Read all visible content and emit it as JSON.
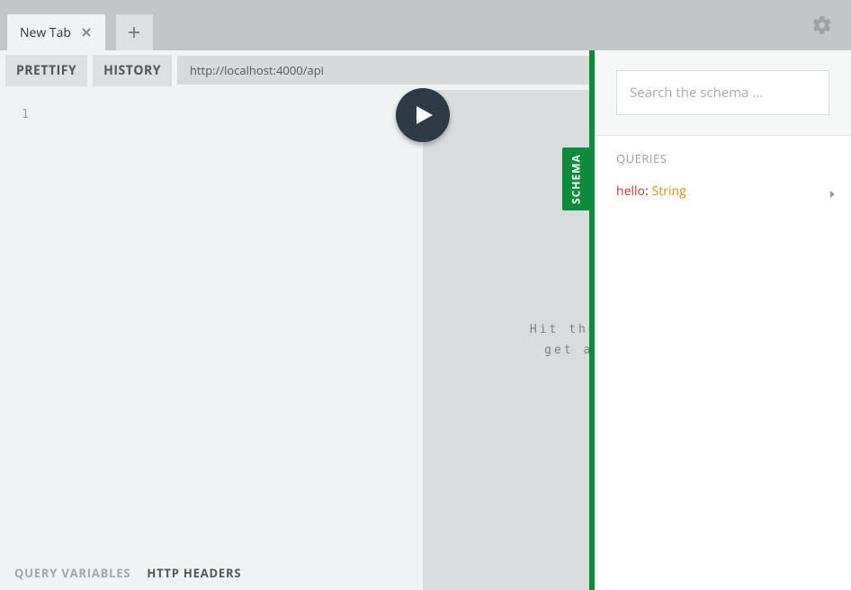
{
  "tabs": {
    "items": [
      {
        "label": "New Tab"
      }
    ]
  },
  "toolbar": {
    "prettify": "PRETTIFY",
    "history": "HISTORY",
    "url": "http://localhost:4000/api"
  },
  "editor": {
    "line1": "1"
  },
  "bottom_tabs": {
    "query_variables": "QUERY VARIABLES",
    "http_headers": "HTTP HEADERS"
  },
  "result": {
    "placeholder_line1": "Hit the Play Button to",
    "placeholder_line2": "get a response here"
  },
  "schema_tab": {
    "label": "SCHEMA"
  },
  "docs": {
    "search_placeholder": "Search the schema ...",
    "queries_title": "QUERIES",
    "entries": [
      {
        "name": "hello",
        "type": "String"
      }
    ]
  }
}
